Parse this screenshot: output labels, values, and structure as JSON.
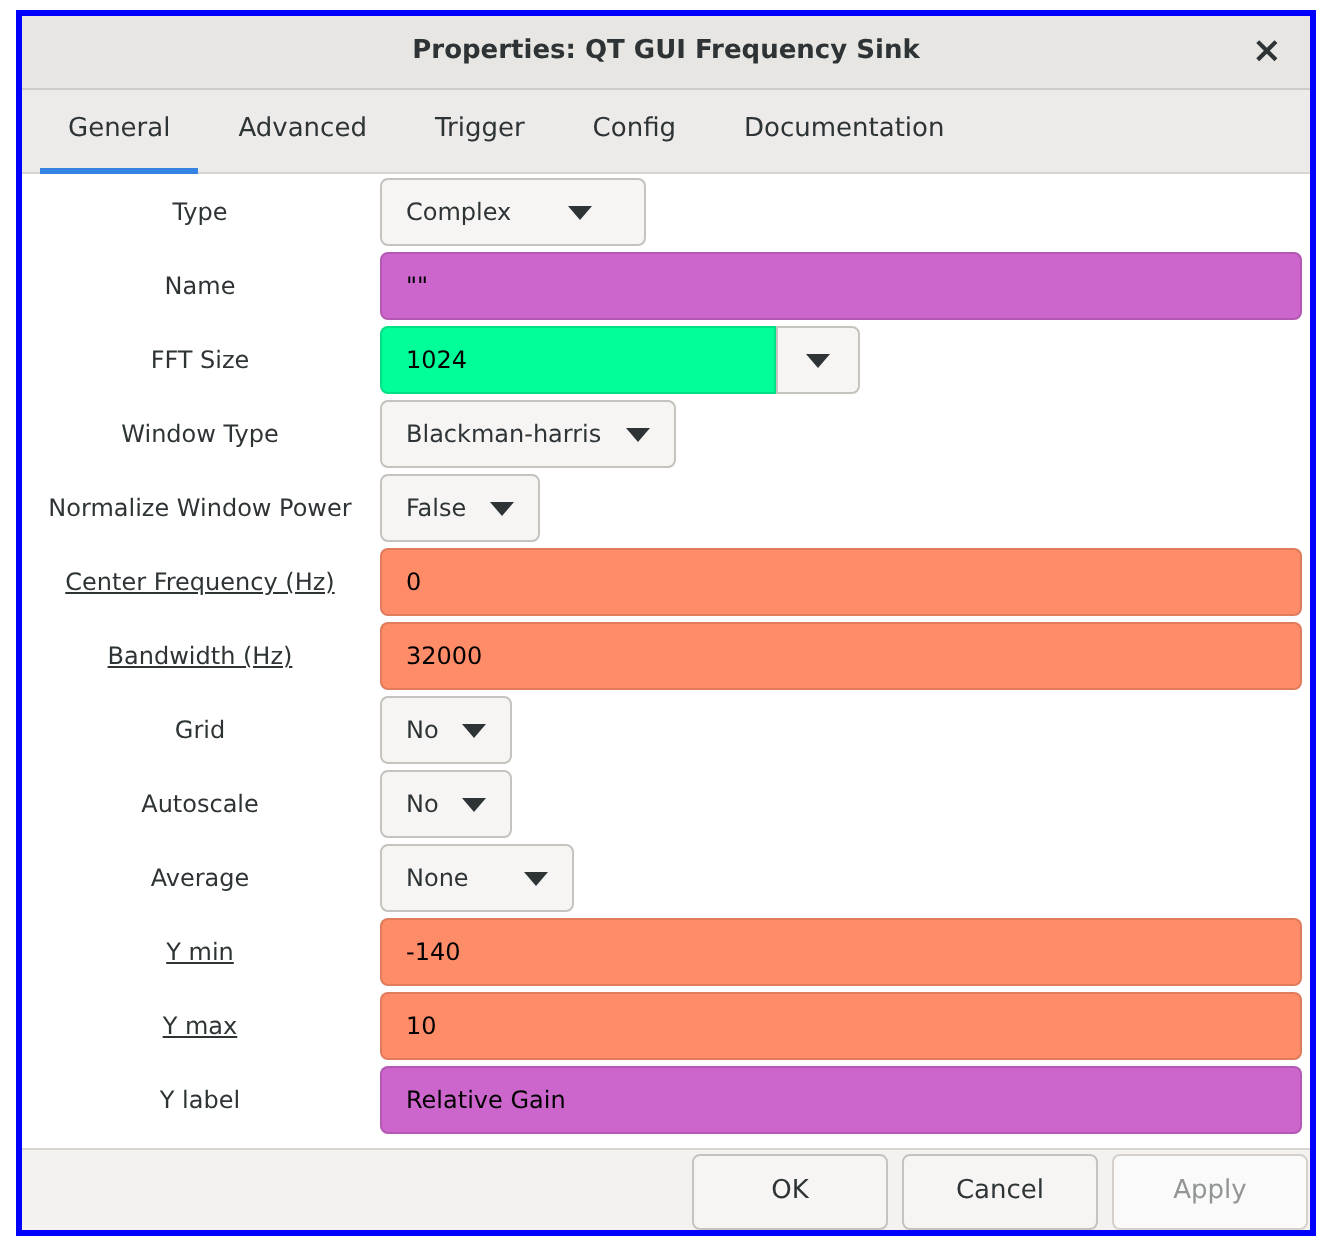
{
  "window": {
    "title": "Properties: QT GUI Frequency Sink",
    "close": "×"
  },
  "tabs": [
    {
      "label": "General",
      "selected": true
    },
    {
      "label": "Advanced",
      "selected": false
    },
    {
      "label": "Trigger",
      "selected": false
    },
    {
      "label": "Config",
      "selected": false
    },
    {
      "label": "Documentation",
      "selected": false
    }
  ],
  "fields": [
    {
      "kind": "dropdown",
      "label": "Type",
      "underlined": false,
      "value": "Complex"
    },
    {
      "kind": "entry",
      "label": "Name",
      "underlined": false,
      "value": "\"\"",
      "color": "#cc66cc"
    },
    {
      "kind": "combo",
      "label": "FFT Size",
      "underlined": false,
      "value": "1024",
      "color": "#00ff99"
    },
    {
      "kind": "dropdown",
      "label": "Window Type",
      "underlined": false,
      "value": "Blackman-harris"
    },
    {
      "kind": "dropdown",
      "label": "Normalize Window Power",
      "underlined": false,
      "value": "False"
    },
    {
      "kind": "entry",
      "label": "Center Frequency (Hz)",
      "underlined": true,
      "value": "0",
      "color": "#ff8c69"
    },
    {
      "kind": "entry",
      "label": "Bandwidth (Hz)",
      "underlined": true,
      "value": "32000",
      "color": "#ff8c69"
    },
    {
      "kind": "dropdown",
      "label": "Grid",
      "underlined": false,
      "value": "No"
    },
    {
      "kind": "dropdown",
      "label": "Autoscale",
      "underlined": false,
      "value": "No"
    },
    {
      "kind": "dropdown",
      "label": "Average",
      "underlined": false,
      "value": "None"
    },
    {
      "kind": "entry",
      "label": "Y min",
      "underlined": true,
      "value": "-140",
      "color": "#ff8c69"
    },
    {
      "kind": "entry",
      "label": "Y max",
      "underlined": true,
      "value": "10",
      "color": "#ff8c69"
    },
    {
      "kind": "entry",
      "label": "Y label",
      "underlined": false,
      "value": "Relative Gain",
      "color": "#cc66cc"
    }
  ],
  "buttons": [
    {
      "label": "OK",
      "disabled": false
    },
    {
      "label": "Cancel",
      "disabled": false
    },
    {
      "label": "Apply",
      "disabled": true
    }
  ]
}
